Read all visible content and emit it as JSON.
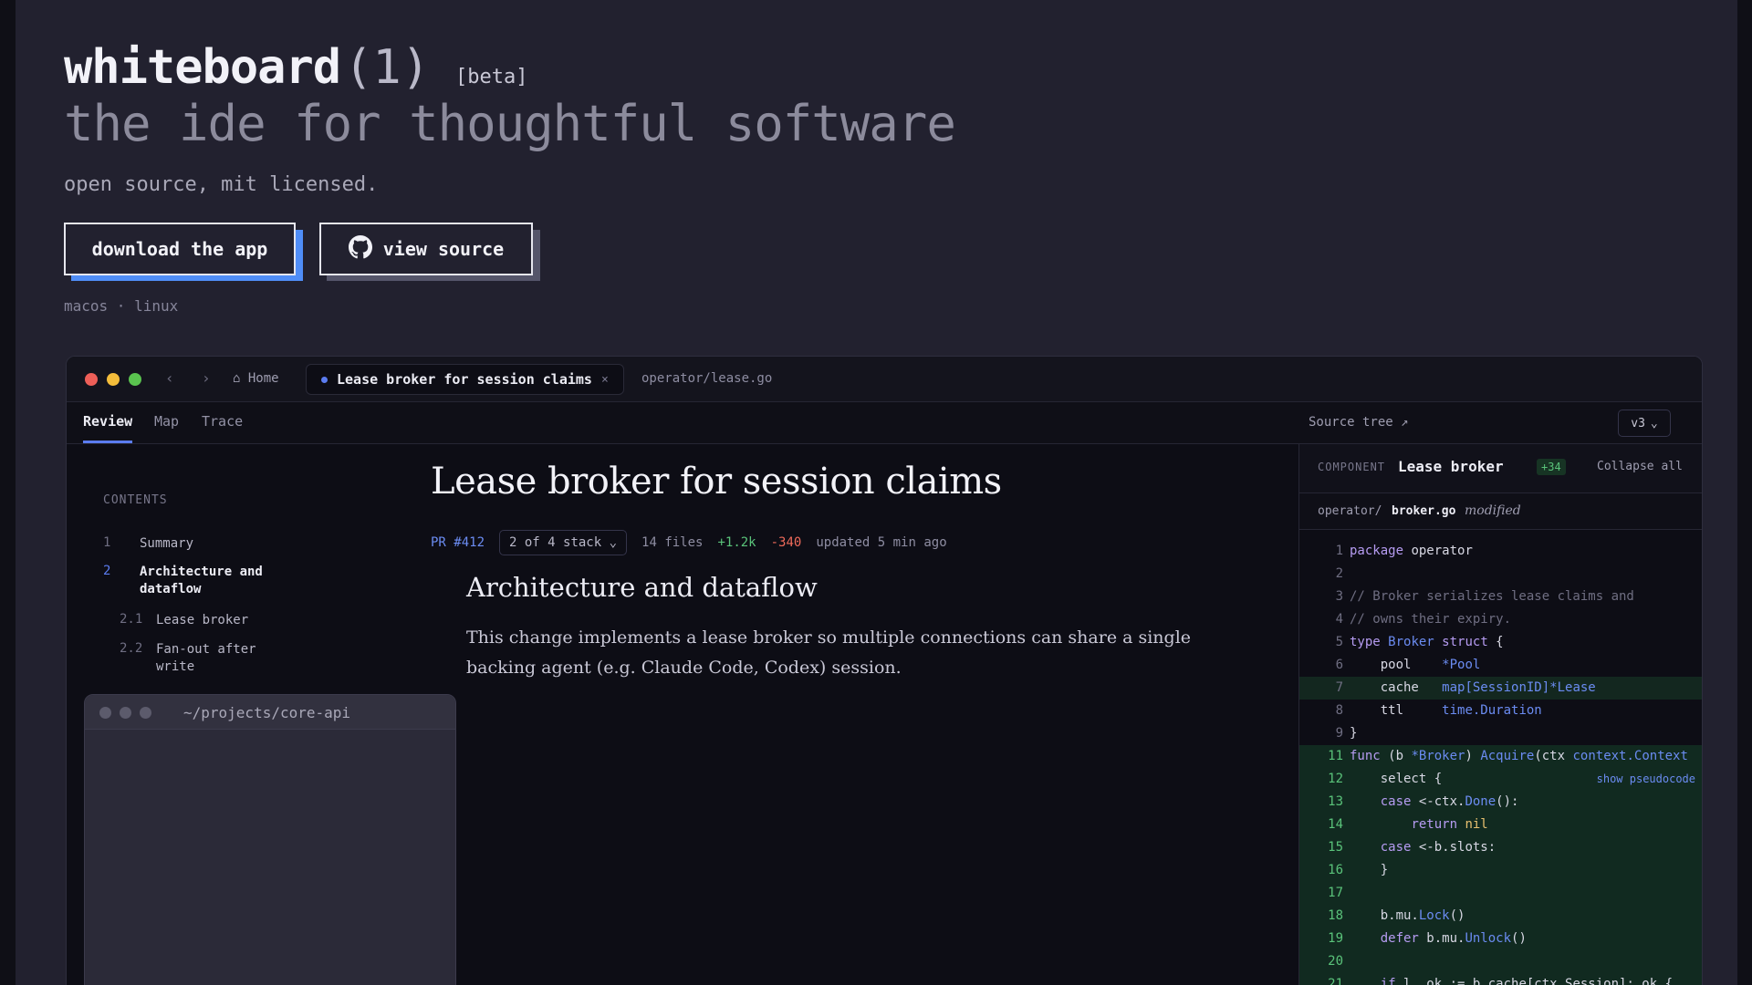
{
  "hero": {
    "app_name": "whiteboard",
    "app_suffix": "(1)",
    "beta_tag": "[beta]",
    "tagline": "the ide for thoughtful software",
    "license": "open source, mit licensed.",
    "download_label": "download the app",
    "source_label": "view source",
    "platforms": "macos · linux"
  },
  "window": {
    "nav_back": "‹",
    "nav_forward": "›",
    "home_tab": "⌂ Home",
    "doc_tab": "Lease broker for session claims",
    "doc_tab_close": "×",
    "file_tab": "operator/lease.go",
    "view_tabs": [
      "Review",
      "Map",
      "Trace"
    ],
    "source_tree": "Source tree ↗",
    "version": "v3",
    "version_caret": "⌄"
  },
  "toc": {
    "heading": "CONTENTS",
    "items": [
      {
        "num": "1",
        "label": "Summary"
      },
      {
        "num": "2",
        "label": "Architecture and dataflow"
      },
      {
        "num": "2.1",
        "label": "Lease broker"
      },
      {
        "num": "2.2",
        "label": "Fan-out after write"
      }
    ]
  },
  "terminal": {
    "title": "~/projects/core-api"
  },
  "doc": {
    "title": "Lease broker for session claims",
    "pr": "PR #412",
    "stack": "2 of 4 stack ⌄",
    "files": "14 files",
    "additions": "+1.2k",
    "deletions": "-340",
    "updated": "updated 5 min ago",
    "section_title": "Architecture and dataflow",
    "section_body": "This change implements a lease broker so multiple connections can share a single backing agent (e.g. Claude Code, Codex) session."
  },
  "component": {
    "label": "COMPONENT",
    "name": "Lease broker",
    "badge": "+34",
    "collapse_all": "Collapse all",
    "path_dir": "operator/",
    "path_file": "broker.go",
    "path_status": "modified",
    "show_pseudocode": "show pseudocode",
    "code": [
      {
        "n": "1",
        "text": "package operator"
      },
      {
        "n": "2",
        "text": ""
      },
      {
        "n": "3",
        "text": "// Broker serializes lease claims and"
      },
      {
        "n": "4",
        "text": "// owns their expiry."
      },
      {
        "n": "5",
        "text": "type Broker struct {"
      },
      {
        "n": "6",
        "text": "    pool    *Pool"
      },
      {
        "n": "7",
        "text": "    cache   map[SessionID]*Lease"
      },
      {
        "n": "8",
        "text": "    ttl     time.Duration"
      },
      {
        "n": "9",
        "text": "}"
      },
      {
        "n": "11",
        "text": "func (b *Broker) Acquire(ctx context.Context"
      },
      {
        "n": "12",
        "text": "    select {"
      },
      {
        "n": "13",
        "text": "    case <-ctx.Done():"
      },
      {
        "n": "14",
        "text": "        return nil"
      },
      {
        "n": "15",
        "text": "    case <-b.slots:"
      },
      {
        "n": "16",
        "text": "    }"
      },
      {
        "n": "17",
        "text": ""
      },
      {
        "n": "18",
        "text": "    b.mu.Lock()"
      },
      {
        "n": "19",
        "text": "    defer b.mu.Unlock()"
      },
      {
        "n": "20",
        "text": ""
      },
      {
        "n": "21",
        "text": "    if l, ok := b.cache[ctx.Session]; ok {"
      }
    ]
  }
}
